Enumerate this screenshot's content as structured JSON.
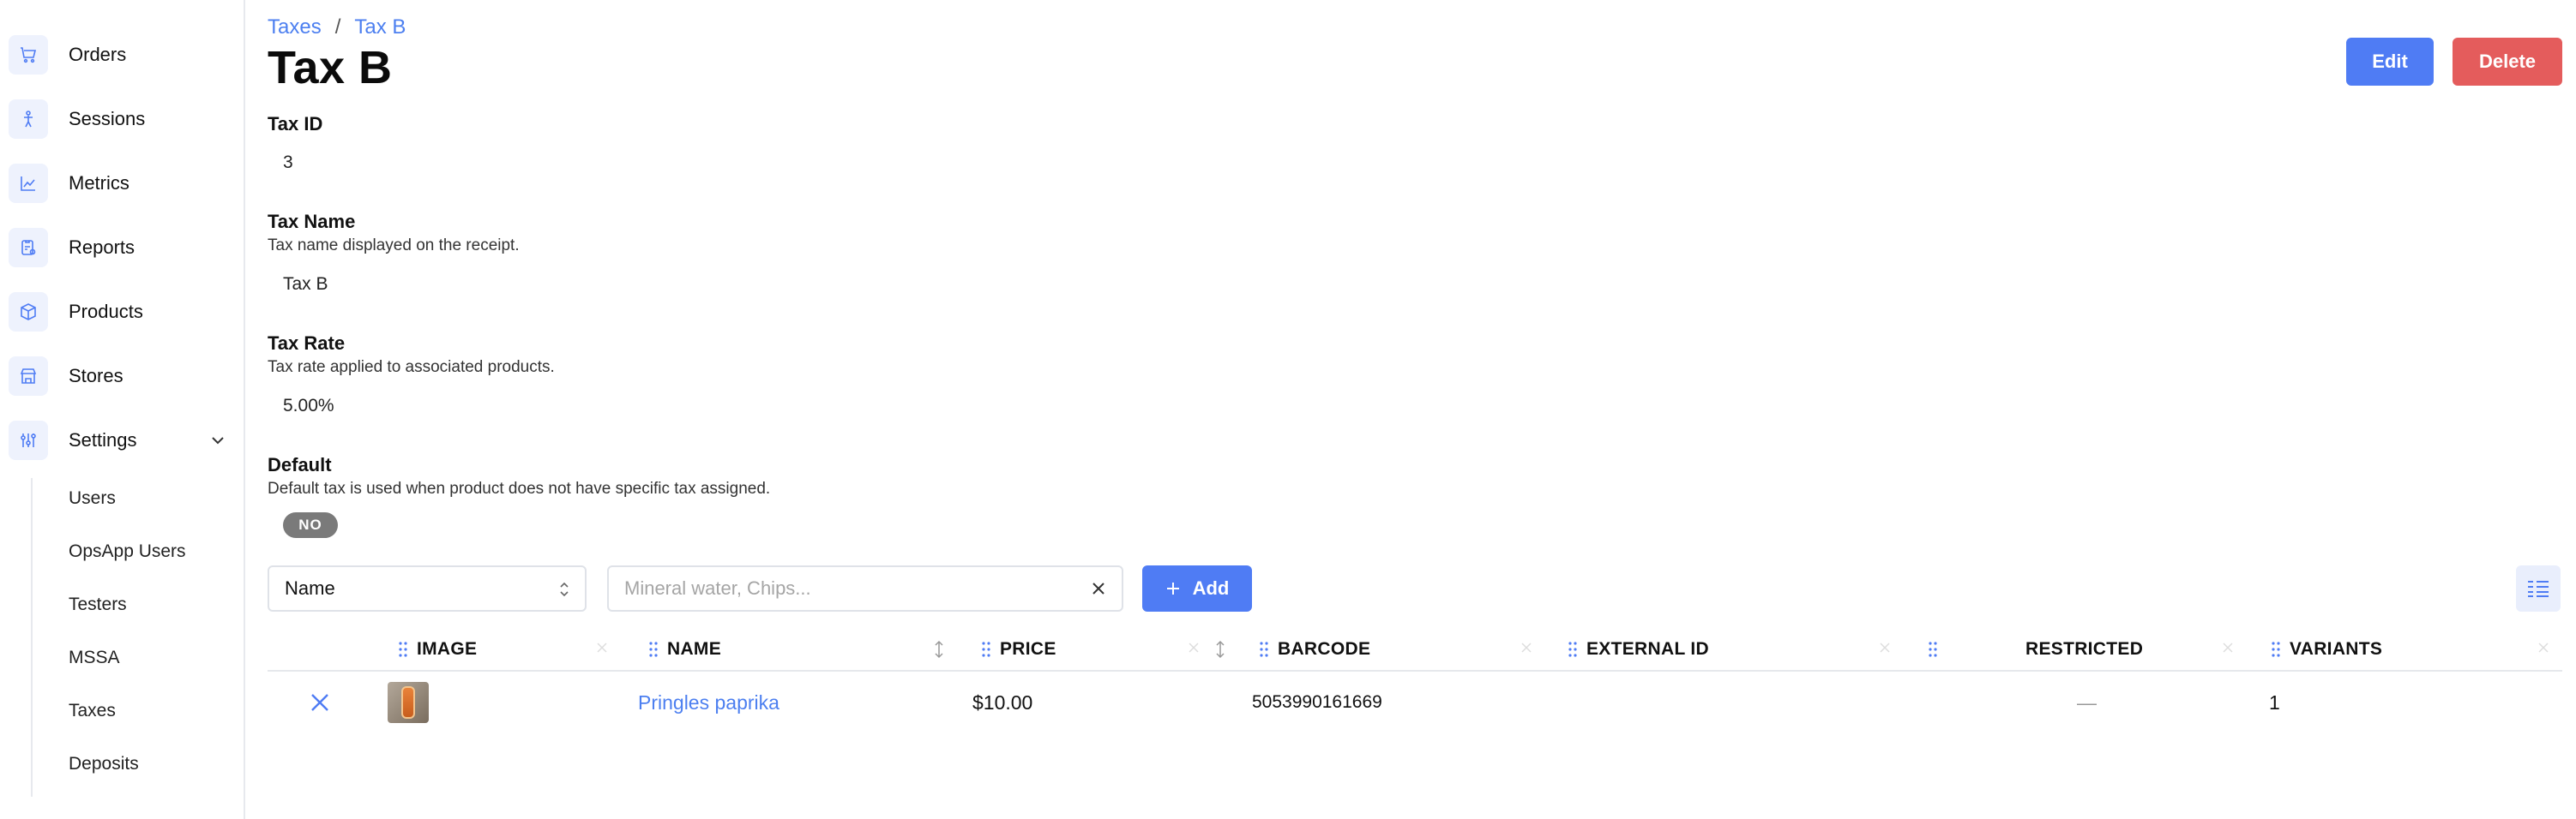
{
  "sidebar": {
    "items": [
      {
        "label": "Orders",
        "icon": "cart-icon"
      },
      {
        "label": "Sessions",
        "icon": "person-icon"
      },
      {
        "label": "Metrics",
        "icon": "chart-icon"
      },
      {
        "label": "Reports",
        "icon": "report-icon"
      },
      {
        "label": "Products",
        "icon": "box-icon"
      },
      {
        "label": "Stores",
        "icon": "store-icon"
      },
      {
        "label": "Settings",
        "icon": "sliders-icon"
      }
    ],
    "settings_sub": [
      "Users",
      "OpsApp Users",
      "Testers",
      "MSSA",
      "Taxes",
      "Deposits"
    ]
  },
  "breadcrumb": {
    "parent": "Taxes",
    "separator": "/",
    "current": "Tax B"
  },
  "title": "Tax B",
  "actions": {
    "edit": "Edit",
    "delete": "Delete"
  },
  "fields": {
    "tax_id": {
      "label": "Tax ID",
      "value": "3"
    },
    "tax_name": {
      "label": "Tax Name",
      "help": "Tax name displayed on the receipt.",
      "value": "Tax B"
    },
    "tax_rate": {
      "label": "Tax Rate",
      "help": "Tax rate applied to associated products.",
      "value": "5.00%"
    },
    "default": {
      "label": "Default",
      "help": "Default tax is used when product does not have specific tax assigned.",
      "value": "NO"
    }
  },
  "toolbar": {
    "filter_select": "Name",
    "search_placeholder": "Mineral water, Chips...",
    "add_label": "Add"
  },
  "table": {
    "headers": [
      "IMAGE",
      "NAME",
      "PRICE",
      "BARCODE",
      "EXTERNAL ID",
      "RESTRICTED",
      "VARIANTS"
    ],
    "rows": [
      {
        "name": "Pringles paprika",
        "price": "$10.00",
        "barcode": "5053990161669",
        "external_id": "",
        "restricted": "—",
        "variants": "1"
      }
    ]
  },
  "colors": {
    "accent": "#4f7cf4",
    "danger": "#e45c5c",
    "link": "#4c7ff0",
    "icon_bg": "#eef2fd"
  }
}
